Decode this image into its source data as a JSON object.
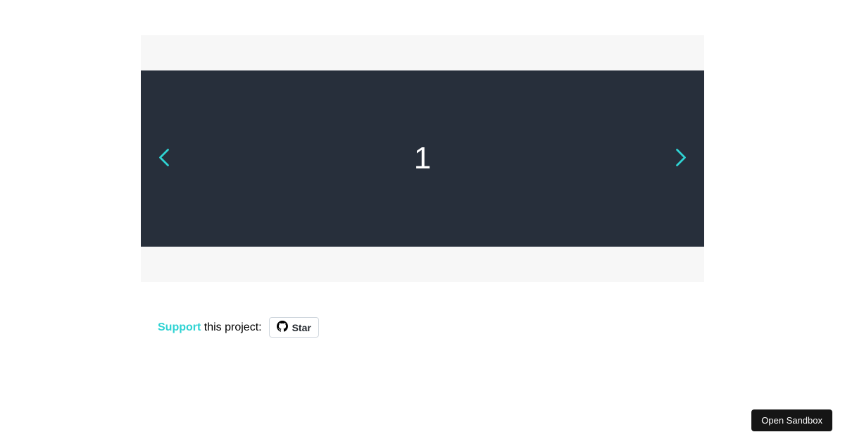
{
  "carousel": {
    "current_slide": "1"
  },
  "support": {
    "link_text": "Support",
    "rest_text": " this project:",
    "star_label": "Star"
  },
  "sandbox": {
    "button_label": "Open Sandbox"
  }
}
